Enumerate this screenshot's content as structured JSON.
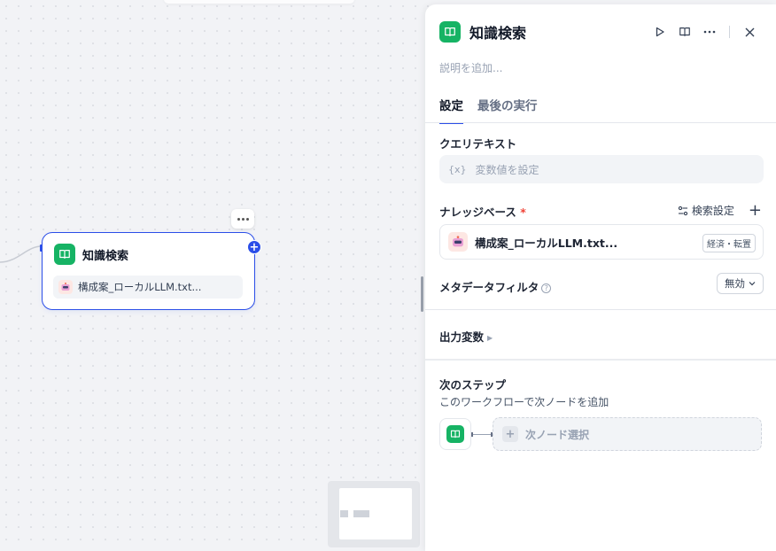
{
  "canvas": {
    "node": {
      "title": "知識検索",
      "file": "構成案_ローカルLLM.txt..."
    }
  },
  "panel": {
    "title": "知識検索",
    "description_placeholder": "説明を追加...",
    "tabs": [
      {
        "label": "設定",
        "active": true
      },
      {
        "label": "最後の実行",
        "active": false
      }
    ],
    "query": {
      "label": "クエリテキスト",
      "var_symbol": "{x}",
      "placeholder": "変数値を設定"
    },
    "knowledge": {
      "label": "ナレッジベース",
      "required_mark": "*",
      "search_settings": "検索設定",
      "item": {
        "name": "構成案_ローカルLLM.txt...",
        "badge": "経済・転置"
      }
    },
    "metadata": {
      "label": "メタデータフィルタ",
      "help": "?",
      "value": "無効"
    },
    "output": {
      "label": "出力変数"
    },
    "next_step": {
      "label": "次のステップ",
      "subtitle": "このワークフローで次ノードを追加",
      "select_label": "次ノード選択"
    }
  },
  "colors": {
    "accent": "#2b4ee8",
    "app_icon": "#16b364"
  }
}
